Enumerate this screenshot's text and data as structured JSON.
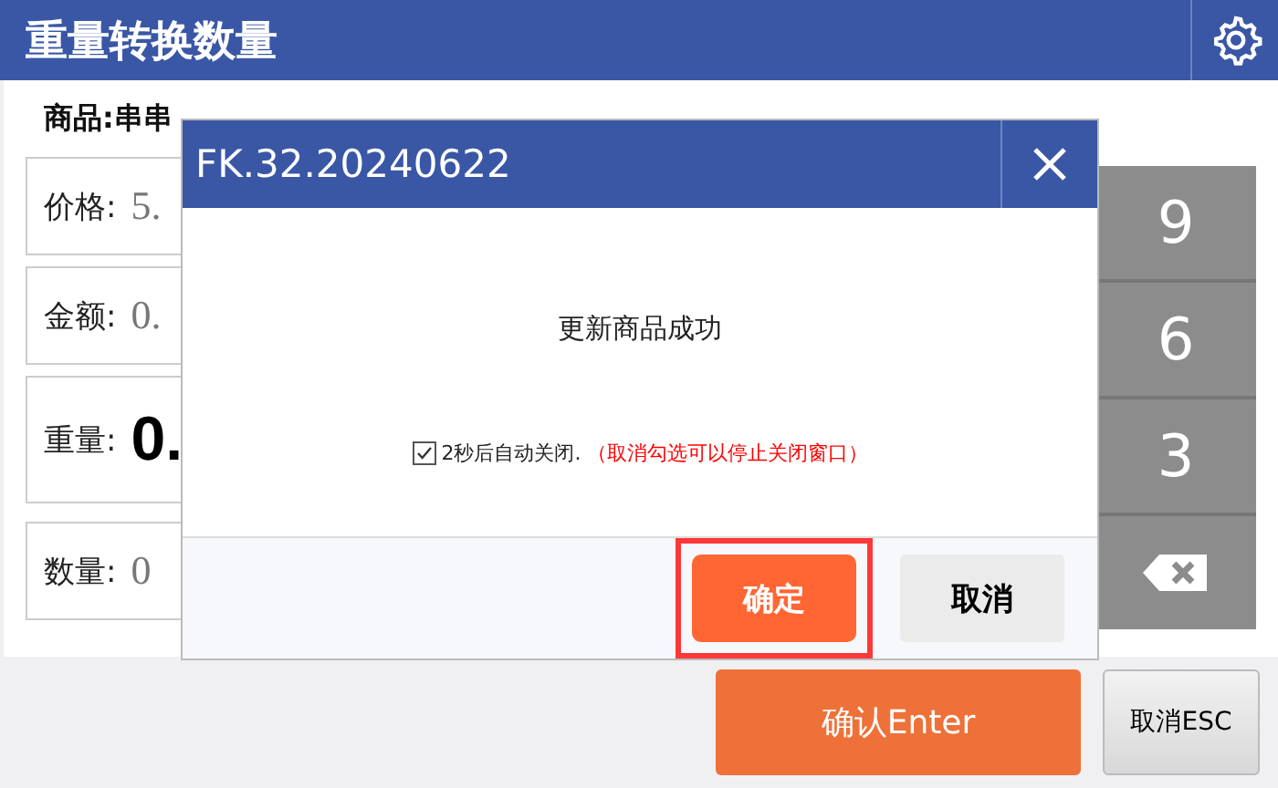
{
  "window": {
    "title": "重量转换数量"
  },
  "product": {
    "label": "商品:串串"
  },
  "fields": [
    {
      "label": "价格:",
      "value": "5.",
      "kind": "normal"
    },
    {
      "label": "金额:",
      "value": "0.",
      "kind": "normal"
    },
    {
      "label": "重量:",
      "value": "0.",
      "kind": "large"
    },
    {
      "label": "数量:",
      "value": "0",
      "kind": "normal"
    }
  ],
  "keypad": [
    {
      "label": "9",
      "kind": "digit"
    },
    {
      "label": "6",
      "kind": "digit"
    },
    {
      "label": "3",
      "kind": "digit"
    },
    {
      "kind": "backspace"
    }
  ],
  "buttons": [
    {
      "label": "确认Enter",
      "kind": "primary"
    },
    {
      "label": "取消ESC",
      "kind": "secondary"
    }
  ],
  "dialog": {
    "title": "FK.32.20240622",
    "message": "更新商品成功",
    "auto_close": {
      "checked": true,
      "label": "2秒后自动关闭.",
      "hint": "（取消勾选可以停止关闭窗口）"
    },
    "buttons": [
      {
        "label": "确定",
        "kind": "primary",
        "focused": true
      },
      {
        "label": "取消",
        "kind": "secondary",
        "focused": false
      }
    ]
  }
}
